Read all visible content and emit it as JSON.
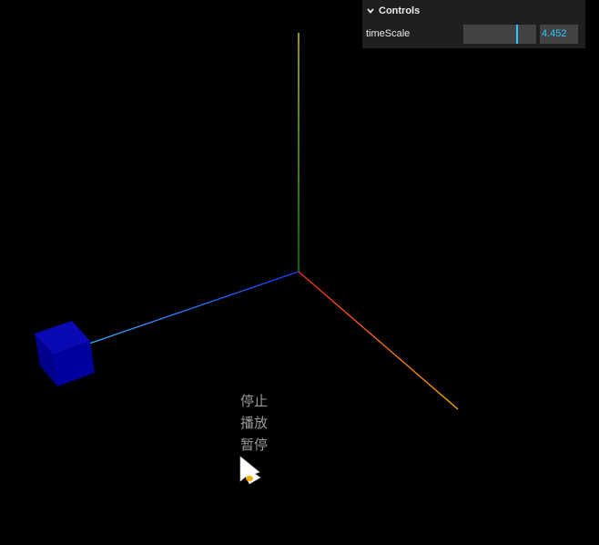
{
  "gui": {
    "title": "Controls",
    "controllers": [
      {
        "name": "timeScale",
        "value": "4.452",
        "fraction": 0.73
      }
    ]
  },
  "menu": {
    "items": [
      "停止",
      "播放",
      "暂停"
    ]
  },
  "scene": {
    "axes": {
      "x_color": "#ff3b2f",
      "x_end_color": "#ffb000",
      "y_color": "#00b000",
      "y_end_color": "#e0e000",
      "z_color": "#2050ff",
      "z_end_color": "#40c0ff"
    },
    "cube_color": "#00009e"
  },
  "icons": {
    "gui_toggle": "chevron-down-icon",
    "pointer": "cursor-arrow-icon"
  }
}
